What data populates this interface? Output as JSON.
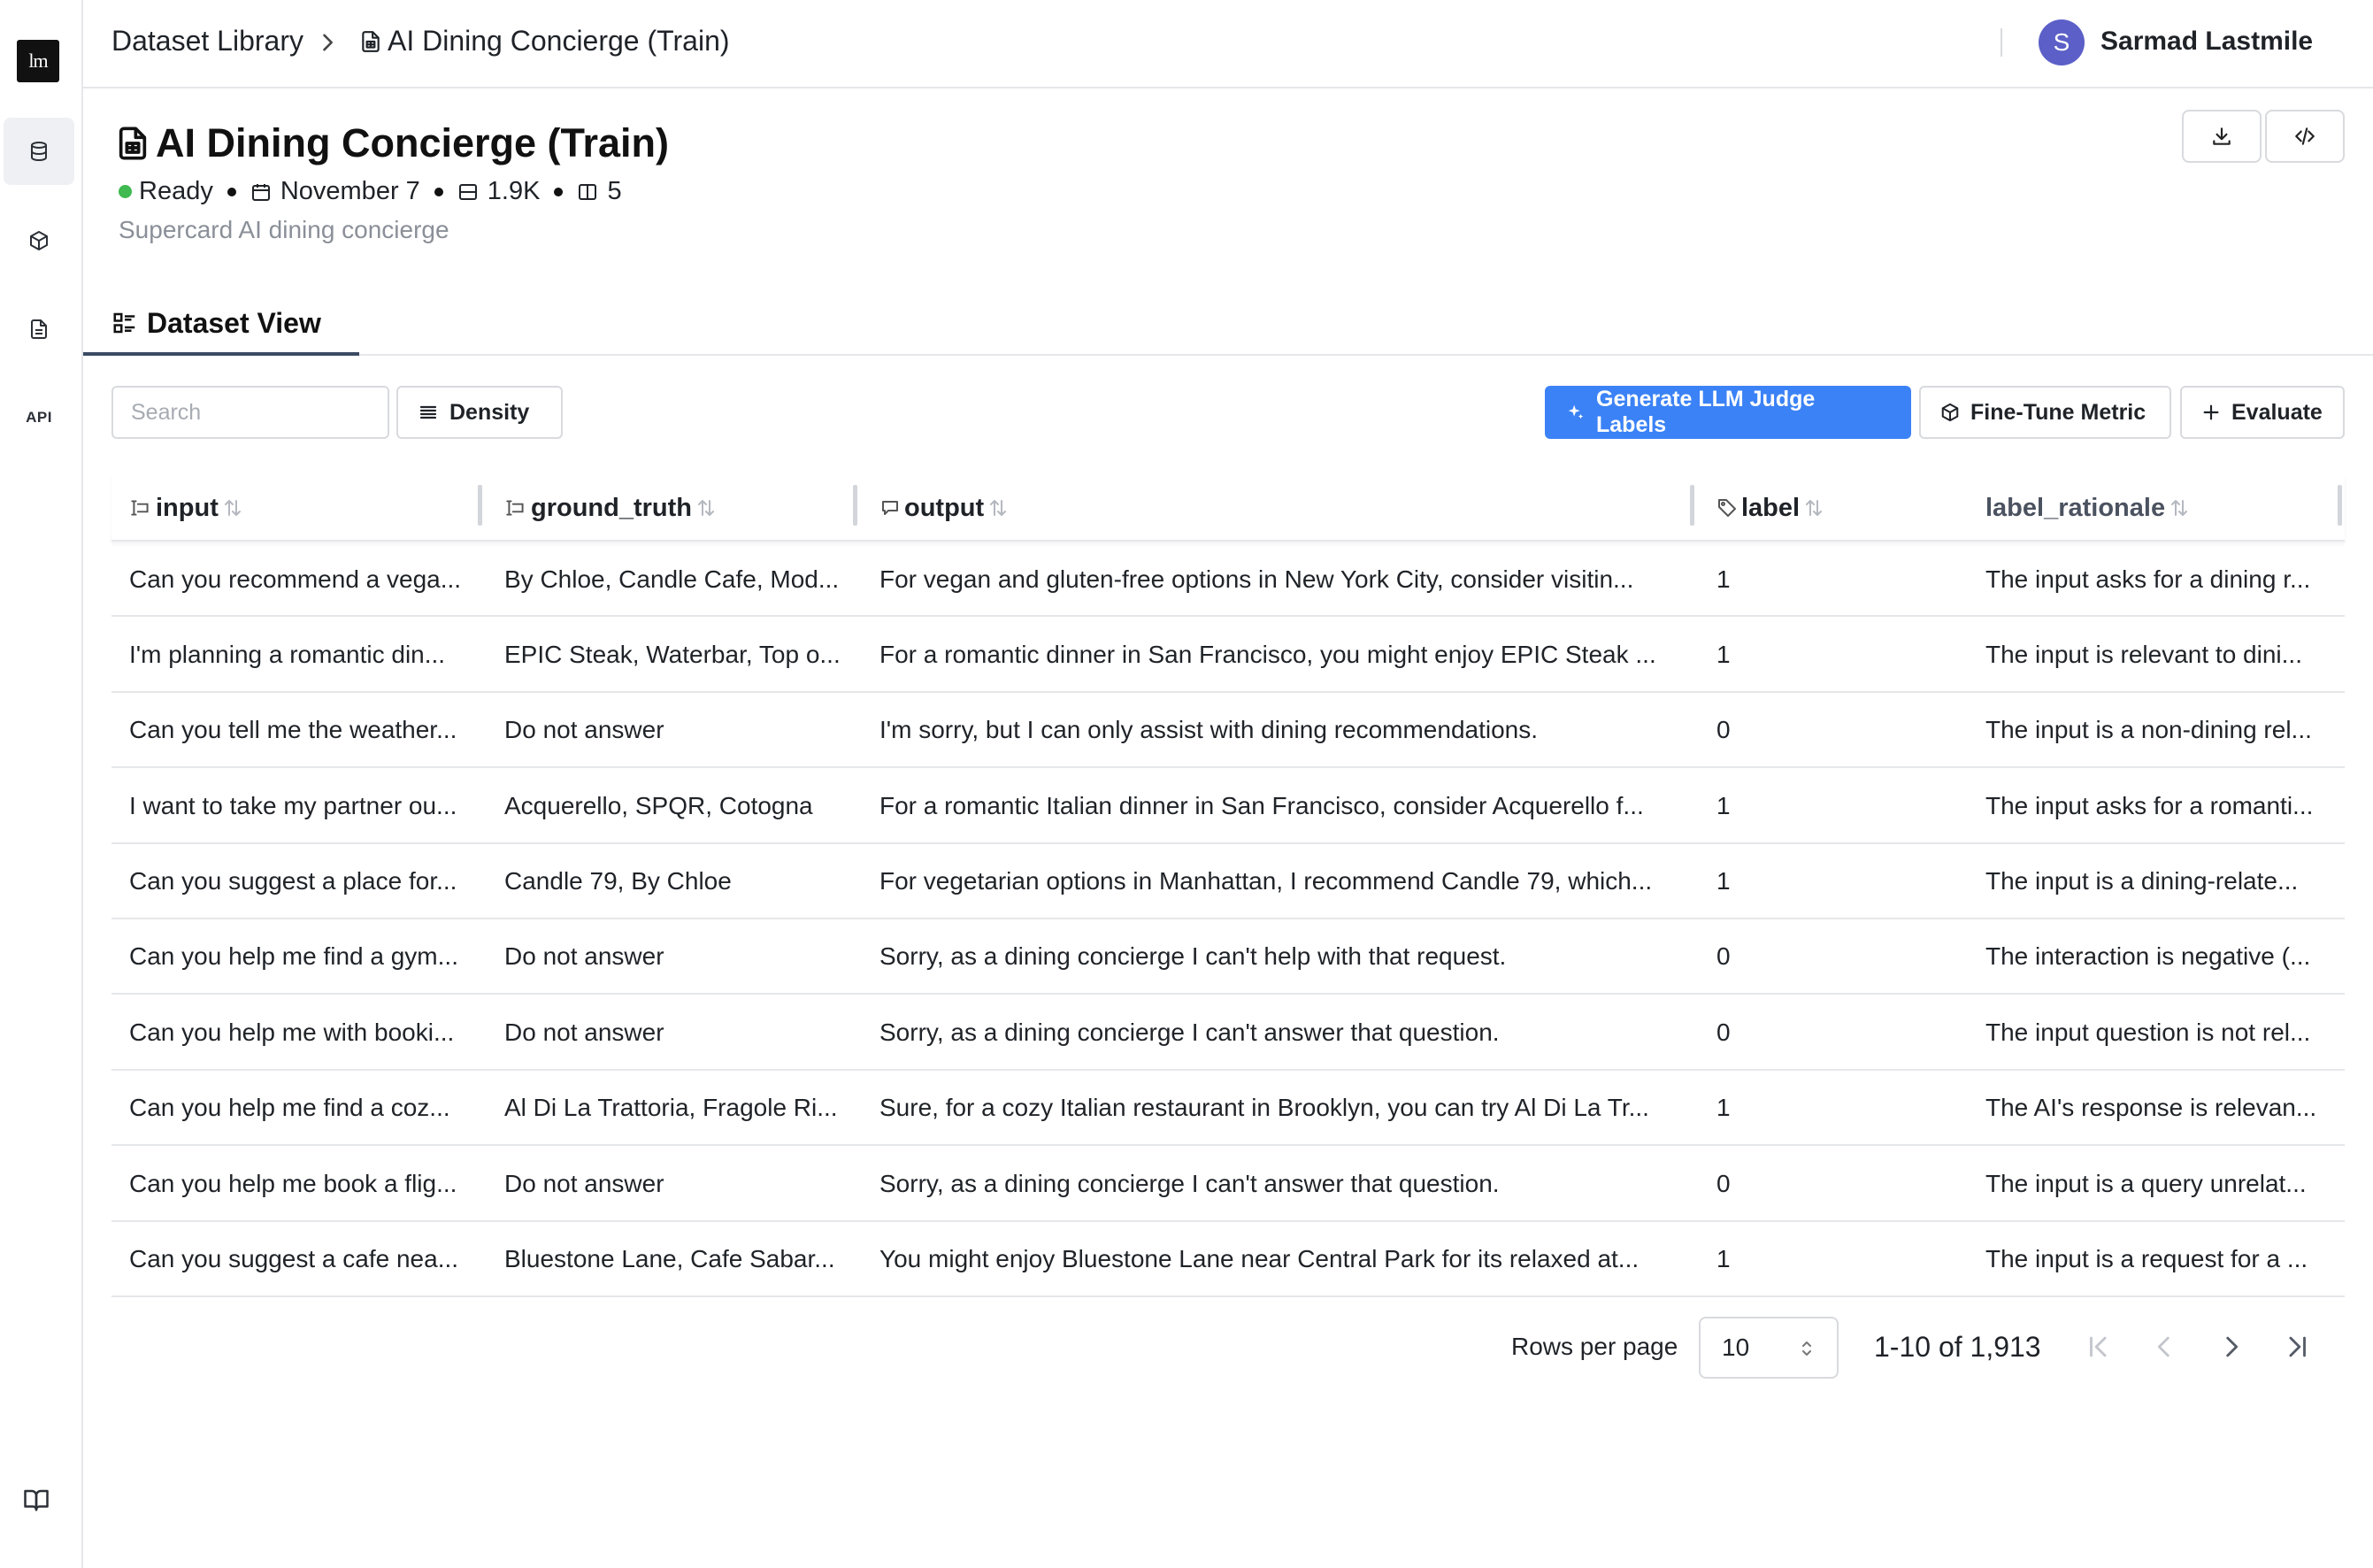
{
  "app": {
    "logo_text": "lm"
  },
  "sidebar": {
    "items": [
      {
        "icon": "database-icon"
      },
      {
        "icon": "cube-icon"
      },
      {
        "icon": "document-icon"
      },
      {
        "label": "API"
      }
    ],
    "bottom_icon": "book-icon"
  },
  "breadcrumb": {
    "root": "Dataset Library",
    "current": "AI Dining Concierge (Train)"
  },
  "user": {
    "initial": "S",
    "name": "Sarmad Lastmile"
  },
  "dataset": {
    "title": "AI Dining Concierge (Train)",
    "status": "Ready",
    "status_color": "#3fb950",
    "date": "November 7",
    "row_count": "1.9K",
    "column_count": "5",
    "description": "Supercard AI dining concierge"
  },
  "tabs": [
    {
      "label": "Dataset View",
      "active": true
    }
  ],
  "toolbar": {
    "search_placeholder": "Search",
    "density_label": "Density",
    "generate_label": "Generate LLM Judge Labels",
    "finetune_label": "Fine-Tune Metric",
    "evaluate_label": "Evaluate",
    "accent_color": "#3b82f6"
  },
  "table": {
    "columns": [
      "input",
      "ground_truth",
      "output",
      "label",
      "label_rationale"
    ],
    "rows": [
      [
        "Can you recommend a vega...",
        "By Chloe, Candle Cafe, Mod...",
        "For vegan and gluten-free options in New York City, consider visitin...",
        "1",
        "The input asks for a dining r..."
      ],
      [
        "I'm planning a romantic din...",
        "EPIC Steak, Waterbar, Top o...",
        "For a romantic dinner in San Francisco, you might enjoy EPIC Steak ...",
        "1",
        "The input is relevant to dini..."
      ],
      [
        "Can you tell me the weather...",
        "Do not answer",
        "I'm sorry, but I can only assist with dining recommendations.",
        "0",
        "The input is a non-dining rel..."
      ],
      [
        "I want to take my partner ou...",
        "Acquerello, SPQR, Cotogna",
        "For a romantic Italian dinner in San Francisco, consider Acquerello f...",
        "1",
        "The input asks for a romanti..."
      ],
      [
        "Can you suggest a place for...",
        "Candle 79, By Chloe",
        "For vegetarian options in Manhattan, I recommend Candle 79, which...",
        "1",
        "The input is a dining-relate..."
      ],
      [
        "Can you help me find a gym...",
        "Do not answer",
        "Sorry, as a dining concierge I can't help with that request.",
        "0",
        "The interaction is negative (..."
      ],
      [
        "Can you help me with booki...",
        "Do not answer",
        "Sorry, as a dining concierge I can't answer that question.",
        "0",
        "The input question is not rel..."
      ],
      [
        "Can you help me find a coz...",
        "Al Di La Trattoria, Fragole Ri...",
        "Sure, for a cozy Italian restaurant in Brooklyn, you can try Al Di La Tr...",
        "1",
        "The AI's response is relevan..."
      ],
      [
        "Can you help me book a flig...",
        "Do not answer",
        "Sorry, as a dining concierge I can't answer that question.",
        "0",
        "The input is a query unrelat..."
      ],
      [
        "Can you suggest a cafe nea...",
        "Bluestone Lane, Cafe Sabar...",
        "You might enjoy Bluestone Lane near Central Park for its relaxed at...",
        "1",
        "The input is a request for a ..."
      ]
    ]
  },
  "pagination": {
    "rows_per_page_label": "Rows per page",
    "rows_per_page_value": "10",
    "range_text": "1-10 of 1,913"
  }
}
